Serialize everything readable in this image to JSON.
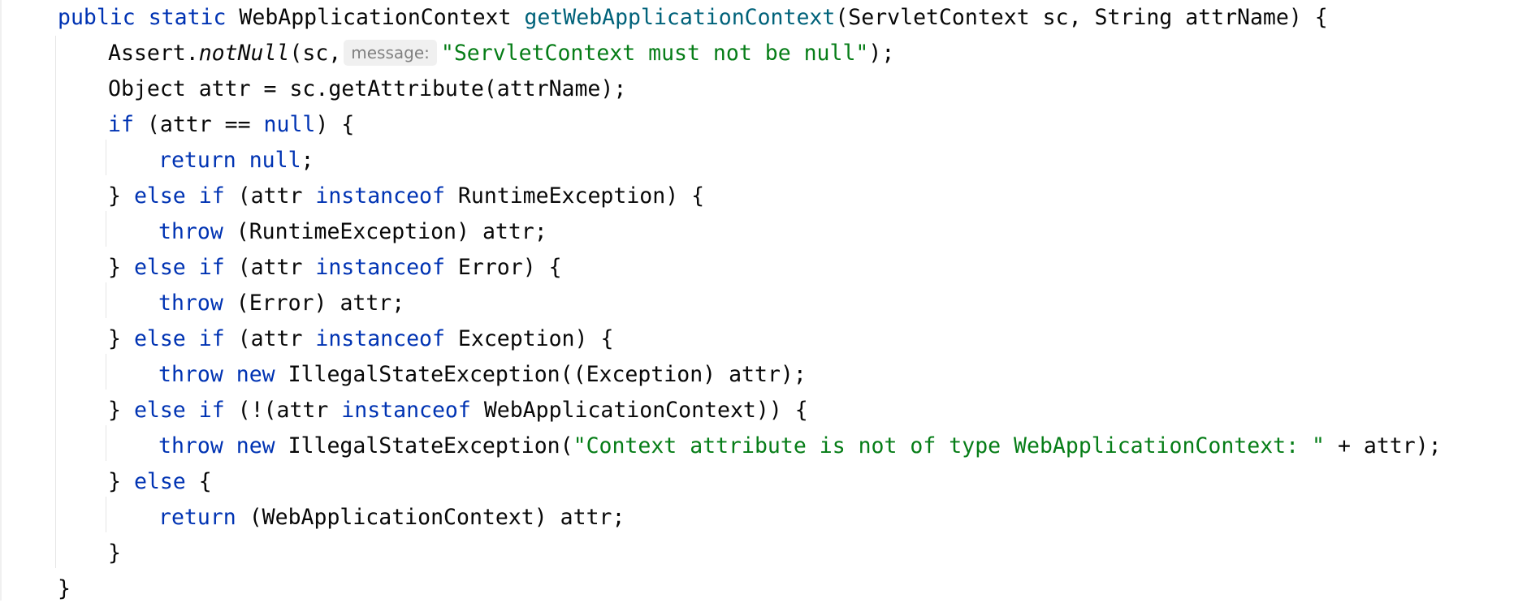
{
  "editor": {
    "language": "java",
    "colors": {
      "keyword": "#0033b3",
      "method_declaration": "#00627a",
      "string": "#067d17",
      "default": "#080808",
      "inlay_hint_bg": "#f0f0f0",
      "inlay_hint_text": "#808080"
    },
    "inlay_hint_label": "message:",
    "lines": [
      "public static WebApplicationContext getWebApplicationContext(ServletContext sc, String attrName) {",
      "Assert.notNull(sc, \"ServletContext must not be null\");",
      "Object attr = sc.getAttribute(attrName);",
      "if (attr == null) {",
      "return null;",
      "} else if (attr instanceof RuntimeException) {",
      "throw (RuntimeException) attr;",
      "} else if (attr instanceof Error) {",
      "throw (Error) attr;",
      "} else if (attr instanceof Exception) {",
      "throw new IllegalStateException((Exception) attr);",
      "} else if (!(attr instanceof WebApplicationContext)) {",
      "throw new IllegalStateException(\"Context attribute is not of type WebApplicationContext: \" + attr);",
      "} else {",
      "return (WebApplicationContext) attr;",
      "}",
      "}"
    ]
  }
}
